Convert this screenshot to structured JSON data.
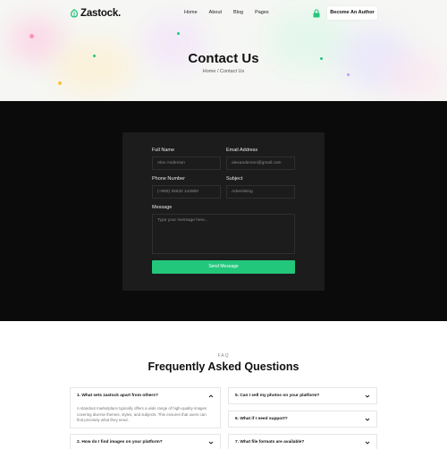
{
  "nav": {
    "logo": "Zastock.",
    "menu": [
      "Home",
      "About",
      "Blog",
      "Pages"
    ],
    "cta": "Become An Author"
  },
  "hero": {
    "title": "Contact Us",
    "breadcrumb": "Home / Contact Us"
  },
  "form": {
    "full_name_label": "Full Name",
    "full_name_value": "Alex Anderson",
    "email_label": "Email Address",
    "email_value": "alexanderson@gmail.com",
    "phone_label": "Phone Number",
    "phone_value": "(+880) 25632 142900",
    "subject_label": "Subject",
    "subject_value": "Advertising",
    "message_label": "Message",
    "message_placeholder": "Type your message here...",
    "submit": "Send Message"
  },
  "faq": {
    "eyebrow": "FAQ",
    "title": "Frequently Asked Questions",
    "items": [
      {
        "question": "1. What sets zastock apart from others?",
        "answer": "A standout marketplace typically offers a wide range of high-quality images covering diverse themes, styles, and subjects. This ensures that users can find precisely what they need."
      },
      {
        "question": "2. How do I find images on your platform?"
      },
      {
        "question": "5. Can I sell my photos on your platform?"
      },
      {
        "question": "6. What if I need support?"
      },
      {
        "question": "7. What file formats are available?"
      }
    ]
  },
  "colors": {
    "accent": "#22c77c",
    "dark_bg": "#0b0b0b",
    "card_bg": "#1c1c1c"
  }
}
